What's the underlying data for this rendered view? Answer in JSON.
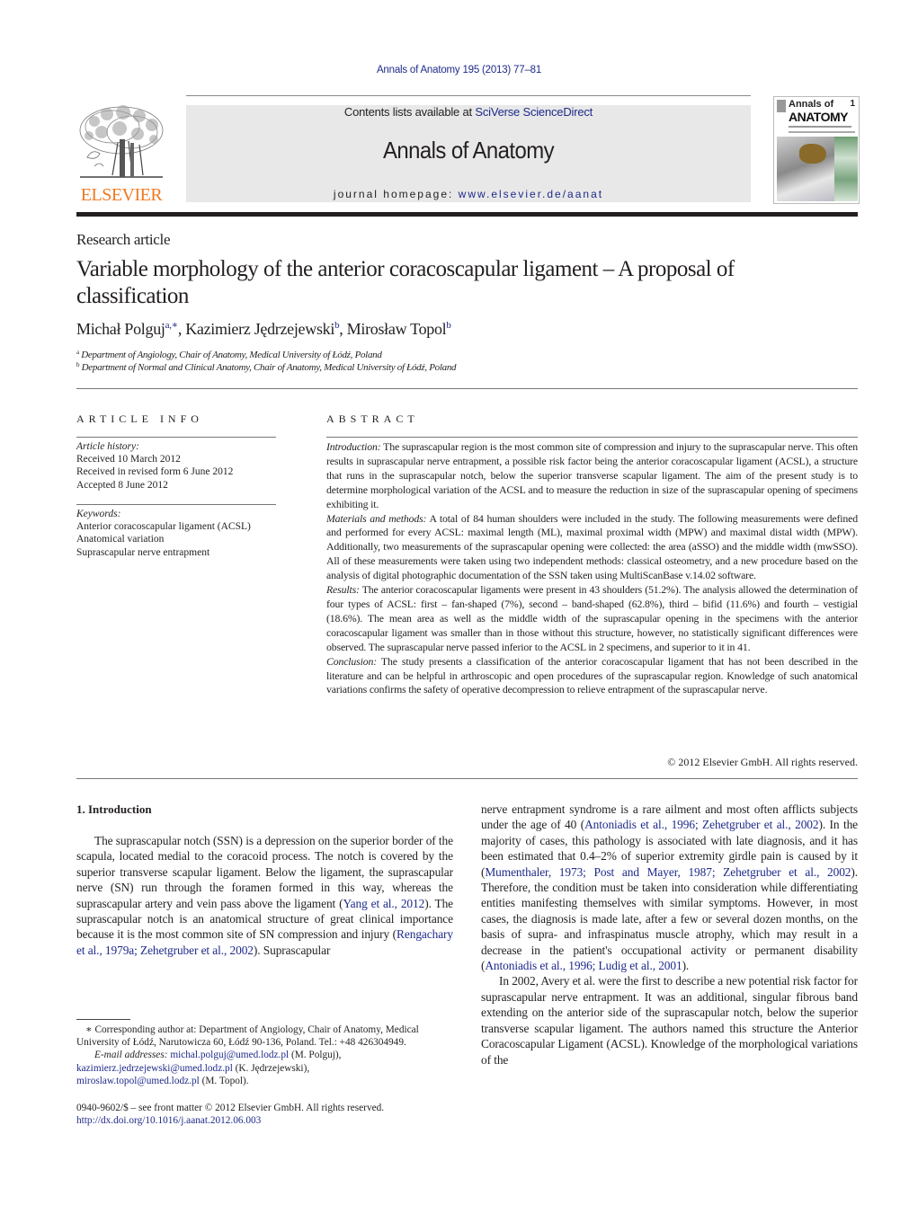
{
  "running_head": "Annals of Anatomy 195 (2013) 77–81",
  "masthead": {
    "publisher_wordmark": "ELSEVIER",
    "contents_prefix": "Contents lists available at ",
    "contents_link": "SciVerse ScienceDirect",
    "journal_title": "Annals of Anatomy",
    "homepage_prefix": "journal homepage: ",
    "homepage_link": "www.elsevier.de/aanat",
    "cover": {
      "title_line1": "Annals of",
      "title_line2": "ANATOMY",
      "issue_number": "1"
    },
    "colors": {
      "publisher_orange": "#f07a22",
      "link_blue": "#1f2a8a",
      "masthead_gray": "#e8e8e8"
    }
  },
  "article": {
    "type": "Research article",
    "title": "Variable morphology of the anterior coracoscapular ligament – A proposal of classification",
    "authors": [
      {
        "name": "Michał Polguj",
        "marks": "a,∗"
      },
      {
        "name": "Kazimierz Jędrzejewski",
        "marks": "b"
      },
      {
        "name": "Mirosław Topol",
        "marks": "b"
      }
    ],
    "affiliations": [
      {
        "mark": "a",
        "text": "Department of Angiology, Chair of Anatomy, Medical University of Łódź, Poland"
      },
      {
        "mark": "b",
        "text": "Department of Normal and Clinical Anatomy, Chair of Anatomy, Medical University of Łódź, Poland"
      }
    ]
  },
  "article_info": {
    "heading": "ARTICLE INFO",
    "history_label": "Article history:",
    "history": [
      "Received 10 March 2012",
      "Received in revised form 6 June 2012",
      "Accepted 8 June 2012"
    ],
    "keywords_label": "Keywords:",
    "keywords": [
      "Anterior coracoscapular ligament (ACSL)",
      "Anatomical variation",
      "Suprascapular nerve entrapment"
    ]
  },
  "abstract": {
    "heading": "ABSTRACT",
    "sections": [
      {
        "label": "Introduction:",
        "text": " The suprascapular region is the most common site of compression and injury to the suprascapular nerve. This often results in suprascapular nerve entrapment, a possible risk factor being the anterior coracoscapular ligament (ACSL), a structure that runs in the suprascapular notch, below the superior transverse scapular ligament. The aim of the present study is to determine morphological variation of the ACSL and to measure the reduction in size of the suprascapular opening of specimens exhibiting it."
      },
      {
        "label": "Materials and methods:",
        "text": " A total of 84 human shoulders were included in the study. The following measurements were defined and performed for every ACSL: maximal length (ML), maximal proximal width (MPW) and maximal distal width (MPW). Additionally, two measurements of the suprascapular opening were collected: the area (aSSO) and the middle width (mwSSO). All of these measurements were taken using two independent methods: classical osteometry, and a new procedure based on the analysis of digital photographic documentation of the SSN taken using MultiScanBase v.14.02 software."
      },
      {
        "label": "Results:",
        "text": " The anterior coracoscapular ligaments were present in 43 shoulders (51.2%). The analysis allowed the determination of four types of ACSL: first – fan-shaped (7%), second – band-shaped (62.8%), third – bifid (11.6%) and fourth – vestigial (18.6%). The mean area as well as the middle width of the suprascapular opening in the specimens with the anterior coracoscapular ligament was smaller than in those without this structure, however, no statistically significant differences were observed. The suprascapular nerve passed inferior to the ACSL in 2 specimens, and superior to it in 41."
      },
      {
        "label": "Conclusion:",
        "text": " The study presents a classification of the anterior coracoscapular ligament that has not been described in the literature and can be helpful in arthroscopic and open procedures of the suprascapular region. Knowledge of such anatomical variations confirms the safety of operative decompression to relieve entrapment of the suprascapular nerve."
      }
    ],
    "copyright": "© 2012 Elsevier GmbH. All rights reserved."
  },
  "introduction": {
    "heading": "1.  Introduction",
    "left_column": {
      "p1_a": "The suprascapular notch (SSN) is a depression on the superior border of the scapula, located medial to the coracoid process. The notch is covered by the superior transverse scapular ligament. Below the ligament, the suprascapular nerve (SN) run through the foramen formed in this way, whereas the suprascapular artery and vein pass above the ligament (",
      "ref1": "Yang et al., 2012",
      "p1_b": "). The suprascapular notch is an anatomical structure of great clinical importance because it is the most common site of SN compression and injury (",
      "ref2": "Rengachary et al., 1979a; Zehetgruber et al., 2002",
      "p1_c": "). Suprascapular"
    },
    "right_column": {
      "p1_a": "nerve entrapment syndrome is a rare ailment and most often afflicts subjects under the age of 40 (",
      "ref1": "Antoniadis et al., 1996; Zehetgruber et al., 2002",
      "p1_b": "). In the majority of cases, this pathology is associated with late diagnosis, and it has been estimated that 0.4–2% of superior extremity girdle pain is caused by it (",
      "ref2": "Mumenthaler, 1973; Post and Mayer, 1987; Zehetgruber et al., 2002",
      "p1_c": "). Therefore, the condition must be taken into consideration while differentiating entities manifesting themselves with similar symptoms. However, in most cases, the diagnosis is made late, after a few or several dozen months, on the basis of supra- and infraspinatus muscle atrophy, which may result in a decrease in the patient's occupational activity or permanent disability (",
      "ref3": "Antoniadis et al., 1996; Ludig et al., 2001",
      "p1_d": ").",
      "p2": "In 2002, Avery et al. were the first to describe a new potential risk factor for suprascapular nerve entrapment. It was an additional, singular fibrous band extending on the anterior side of the suprascapular notch, below the superior transverse scapular ligament. The authors named this structure the Anterior Coracoscapular Ligament (ACSL). Knowledge of the morphological variations of the"
    }
  },
  "footnotes": {
    "corresponding": "∗  Corresponding author at: Department of Angiology, Chair of Anatomy, Medical University of Łódź, Narutowicza 60, Łódź 90-136, Poland. Tel.: +48 426304949.",
    "email_label": "E-mail addresses:",
    "emails": [
      {
        "address": "michal.polguj@umed.lodz.pl",
        "owner": " (M. Polguj),",
        "sep": " "
      },
      {
        "address": "kazimierz.jedrzejewski@umed.lodz.pl",
        "owner": " (K. Jędrzejewski),",
        "sep": ""
      },
      {
        "address": "miroslaw.topol@umed.lodz.pl",
        "owner": " (M. Topol).",
        "sep": ""
      }
    ],
    "front_matter": "0940-9602/$ – see front matter © 2012 Elsevier GmbH. All rights reserved.",
    "doi": "http://dx.doi.org/10.1016/j.aanat.2012.06.003"
  }
}
